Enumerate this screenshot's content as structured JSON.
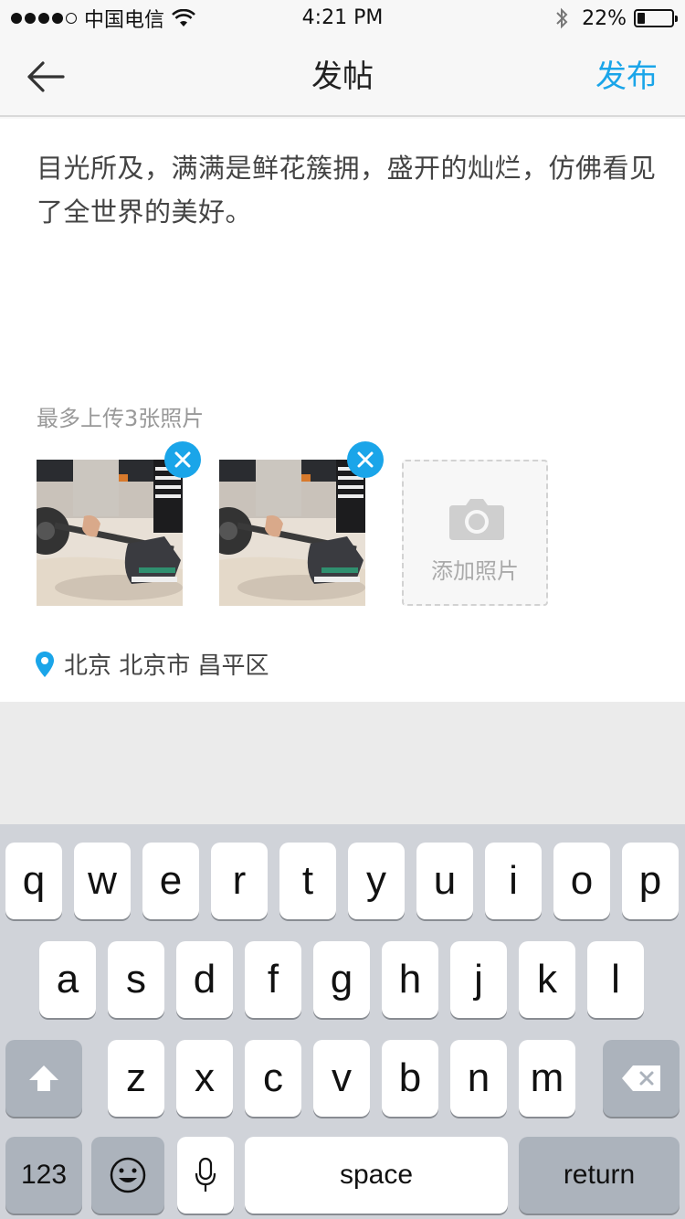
{
  "status_bar": {
    "carrier": "中国电信",
    "time": "4:21 PM",
    "battery_percent": "22%",
    "battery_level": 0.22,
    "signal_bars_filled": 4,
    "signal_bars_total": 5
  },
  "nav": {
    "title": "发帖",
    "publish_label": "发布",
    "back_icon": "arrow-left-icon",
    "accent_color": "#1aa5e9"
  },
  "post": {
    "text": "目光所及，满满是鲜花簇拥，盛开的灿烂，仿佛看见了全世界的美好。"
  },
  "photos": {
    "hint": "最多上传3张照片",
    "items": [
      {
        "name": "photo-1",
        "remove_icon": "close-icon"
      },
      {
        "name": "photo-2",
        "remove_icon": "close-icon"
      }
    ],
    "add_label": "添加照片",
    "add_icon": "camera-icon"
  },
  "location": {
    "icon": "location-pin-icon",
    "text": "北京 北京市 昌平区"
  },
  "keyboard": {
    "row1": [
      "q",
      "w",
      "e",
      "r",
      "t",
      "y",
      "u",
      "i",
      "o",
      "p"
    ],
    "row2": [
      "a",
      "s",
      "d",
      "f",
      "g",
      "h",
      "j",
      "k",
      "l"
    ],
    "row3": [
      "z",
      "x",
      "c",
      "v",
      "b",
      "n",
      "m"
    ],
    "numbers_label": "123",
    "space_label": "space",
    "return_label": "return",
    "shift_icon": "shift-icon",
    "delete_icon": "backspace-icon",
    "emoji_icon": "emoji-icon",
    "mic_icon": "microphone-icon"
  }
}
